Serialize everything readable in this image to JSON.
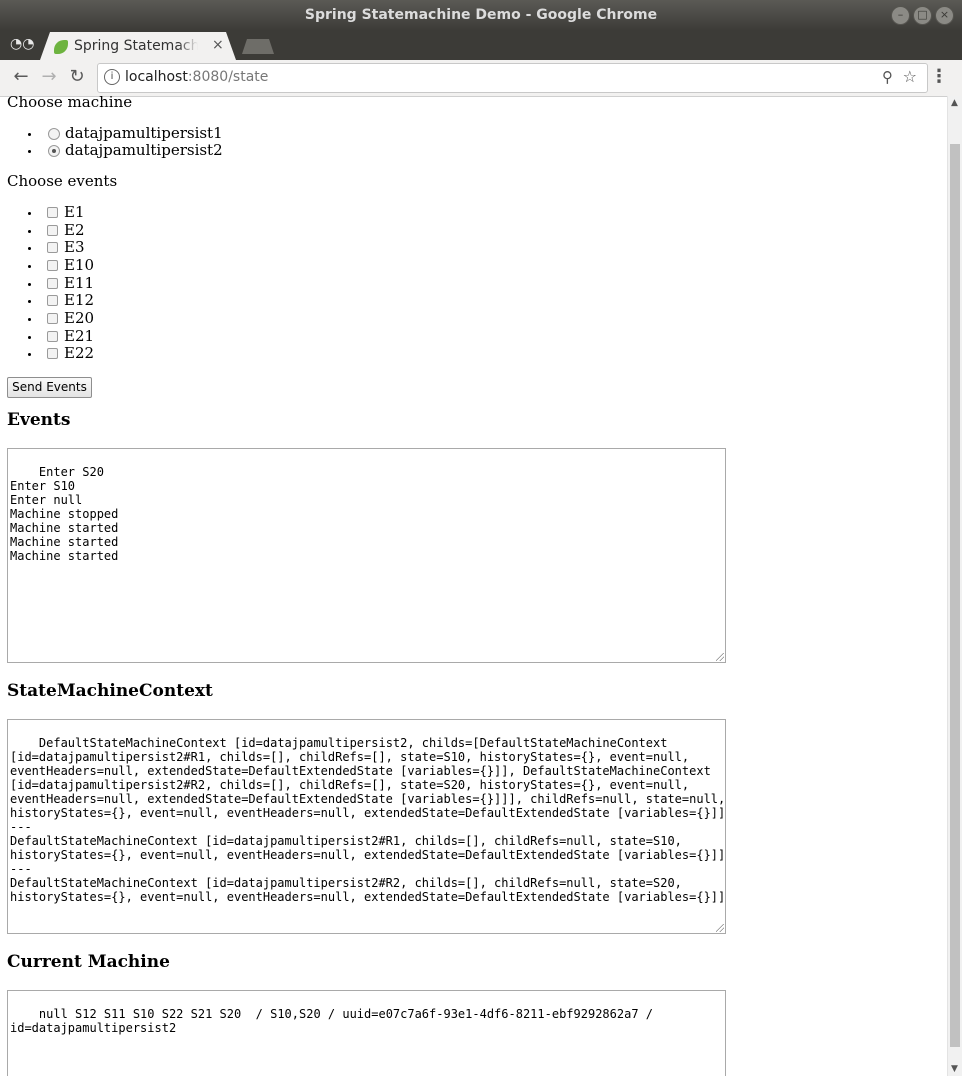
{
  "window": {
    "title": "Spring Statemachine Demo - Google Chrome"
  },
  "tab": {
    "title": "Spring Statemachine Demo",
    "close": "×"
  },
  "address": {
    "host": "localhost",
    "rest": ":8080/state"
  },
  "page": {
    "choose_machine_label": "Choose machine",
    "machines": [
      {
        "label": "datajpamultipersist1",
        "selected": false
      },
      {
        "label": "datajpamultipersist2",
        "selected": true
      }
    ],
    "choose_events_label": "Choose events",
    "events": [
      "E1",
      "E2",
      "E3",
      "E10",
      "E11",
      "E12",
      "E20",
      "E21",
      "E22"
    ],
    "send_button": "Send Events",
    "events_heading": "Events",
    "events_log": "Enter S20\nEnter S10\nEnter null\nMachine stopped\nMachine started\nMachine started\nMachine started",
    "context_heading": "StateMachineContext",
    "context_text": "DefaultStateMachineContext [id=datajpamultipersist2, childs=[DefaultStateMachineContext\n[id=datajpamultipersist2#R1, childs=[], childRefs=[], state=S10, historyStates={}, event=null,\neventHeaders=null, extendedState=DefaultExtendedState [variables={}]], DefaultStateMachineContext\n[id=datajpamultipersist2#R2, childs=[], childRefs=[], state=S20, historyStates={}, event=null,\neventHeaders=null, extendedState=DefaultExtendedState [variables={}]]], childRefs=null, state=null,\nhistoryStates={}, event=null, eventHeaders=null, extendedState=DefaultExtendedState [variables={}]]\n---\nDefaultStateMachineContext [id=datajpamultipersist2#R1, childs=[], childRefs=null, state=S10,\nhistoryStates={}, event=null, eventHeaders=null, extendedState=DefaultExtendedState [variables={}]]\n---\nDefaultStateMachineContext [id=datajpamultipersist2#R2, childs=[], childRefs=null, state=S20,\nhistoryStates={}, event=null, eventHeaders=null, extendedState=DefaultExtendedState [variables={}]]",
    "current_heading": "Current Machine",
    "current_text": "null S12 S11 S10 S22 S21 S20  / S10,S20 / uuid=e07c7a6f-93e1-4df6-8211-ebf9292862a7 /\nid=datajpamultipersist2"
  },
  "colors": {
    "titlebar": "#3d3c38",
    "spring_green": "#6db33f"
  }
}
